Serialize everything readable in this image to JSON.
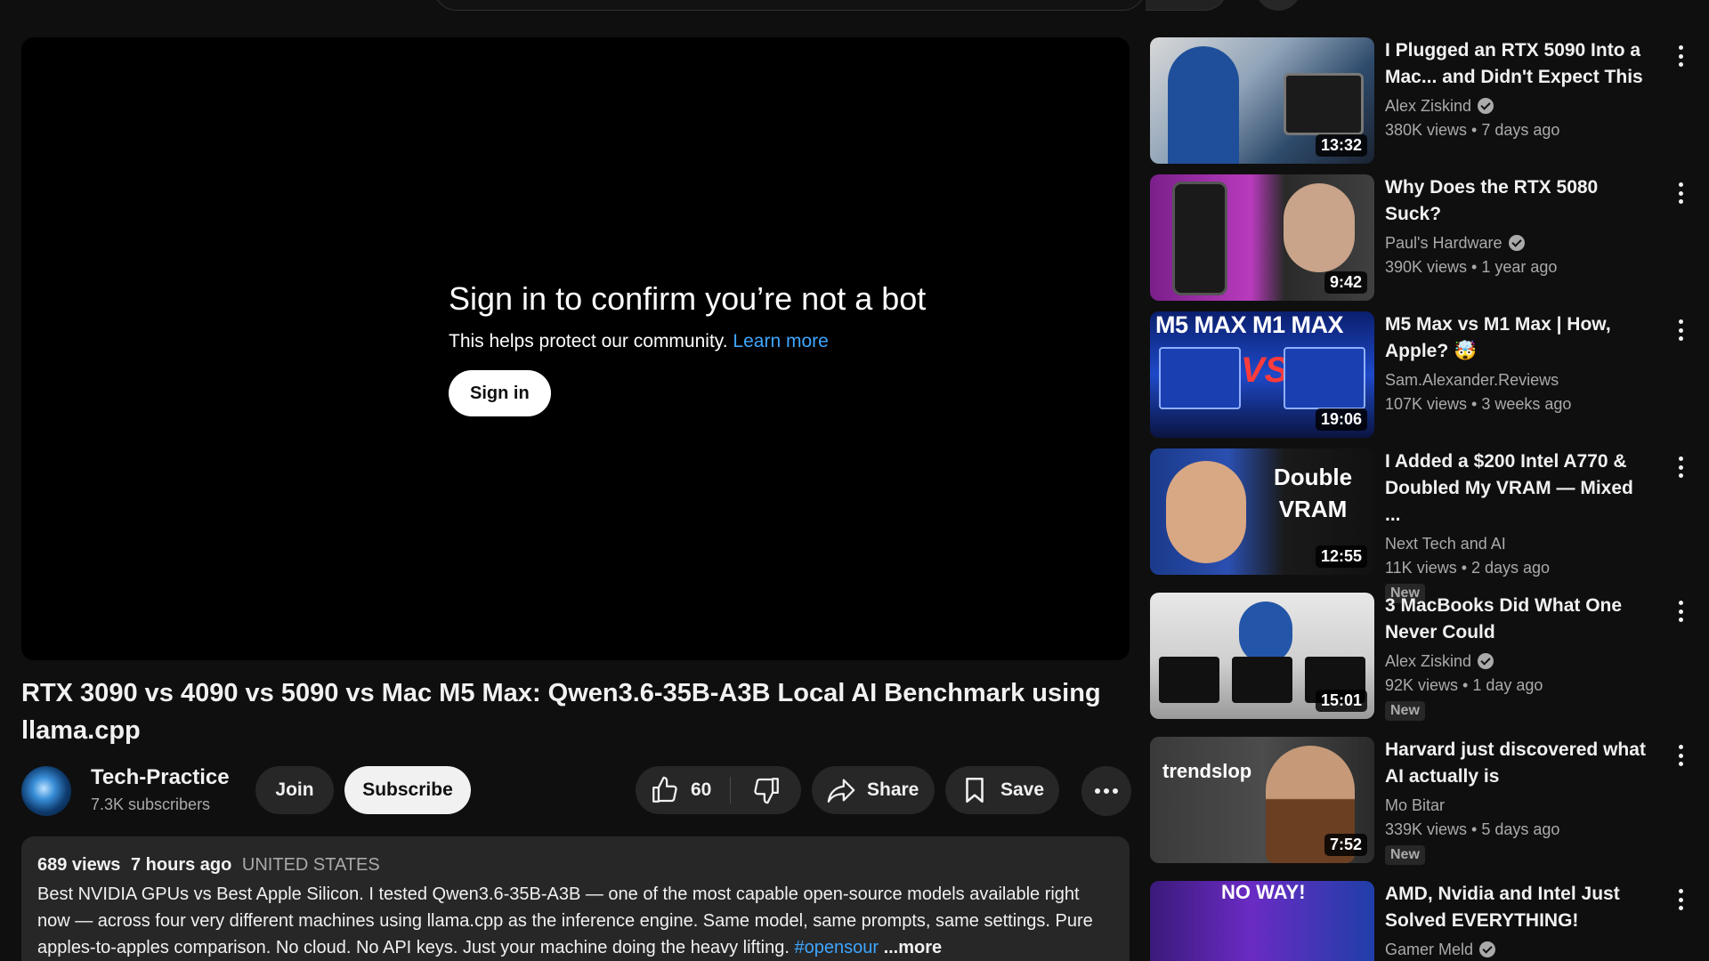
{
  "player": {
    "bot_title": "Sign in to confirm you’re not a bot",
    "bot_text": "This helps protect our community.",
    "bot_link": "Learn more",
    "signin_label": "Sign in"
  },
  "video": {
    "title": "RTX 3090 vs 4090 vs 5090 vs Mac M5 Max: Qwen3.6-35B-A3B Local AI Benchmark using llama.cpp"
  },
  "channel": {
    "name": "Tech-Practice",
    "subscribers": "7.3K subscribers",
    "join_label": "Join",
    "subscribe_label": "Subscribe"
  },
  "actions": {
    "like_count": "60",
    "share_label": "Share",
    "save_label": "Save"
  },
  "description": {
    "views": "689 views",
    "age": "7 hours ago",
    "location": "UNITED STATES",
    "text": "Best NVIDIA GPUs vs Best Apple Silicon. I tested Qwen3.6-35B-A3B — one of the most capable open-source models available right now — across four very different machines using llama.cpp as the inference engine. Same model, same prompts, same settings. Pure apples-to-apples comparison. No cloud. No API keys. Just your machine doing the heavy lifting.",
    "tag": "#opensour",
    "more_label": "...more"
  },
  "recommendations": [
    {
      "title": "I Plugged an RTX 5090 Into a Mac... and Didn't Expect This",
      "channel": "Alex Ziskind",
      "meta": "380K views • 7 days ago",
      "duration": "13:32",
      "badge": ""
    },
    {
      "title": "Why Does the RTX 5080 Suck?",
      "channel": "Paul's Hardware",
      "meta": "390K views • 1 year ago",
      "duration": "9:42",
      "badge": ""
    },
    {
      "title": "M5 Max vs M1 Max | How, Apple? 🤯",
      "channel": "Sam.Alexander.Reviews",
      "meta": "107K views • 3 weeks ago",
      "duration": "19:06",
      "badge": "",
      "thumb_text": "M5 MAX M1 MAX",
      "thumb_vs": "VS"
    },
    {
      "title": "I Added a $200 Intel A770 & Doubled My VRAM — Mixed ...",
      "channel": "Next Tech and AI",
      "meta": "11K views • 2 days ago",
      "duration": "12:55",
      "badge": "New",
      "thumb_text": "Double VRAM"
    },
    {
      "title": "3 MacBooks Did What One Never Could",
      "channel": "Alex Ziskind",
      "meta": "92K views • 1 day ago",
      "duration": "15:01",
      "badge": "New"
    },
    {
      "title": "Harvard just discovered what AI actually is",
      "channel": "Mo Bitar",
      "meta": "339K views • 5 days ago",
      "duration": "7:52",
      "badge": "New",
      "thumb_text": "trendslop"
    },
    {
      "title": "AMD, Nvidia and Intel Just Solved EVERYTHING!",
      "channel": "Gamer Meld",
      "meta": "",
      "duration": "",
      "badge": "",
      "thumb_text": "NO WAY!"
    }
  ],
  "colors": {
    "background": "#0f0f0f",
    "surface": "#272727",
    "link": "#3ea6ff",
    "text_primary": "#f1f1f1",
    "text_secondary": "#aaaaaa"
  }
}
